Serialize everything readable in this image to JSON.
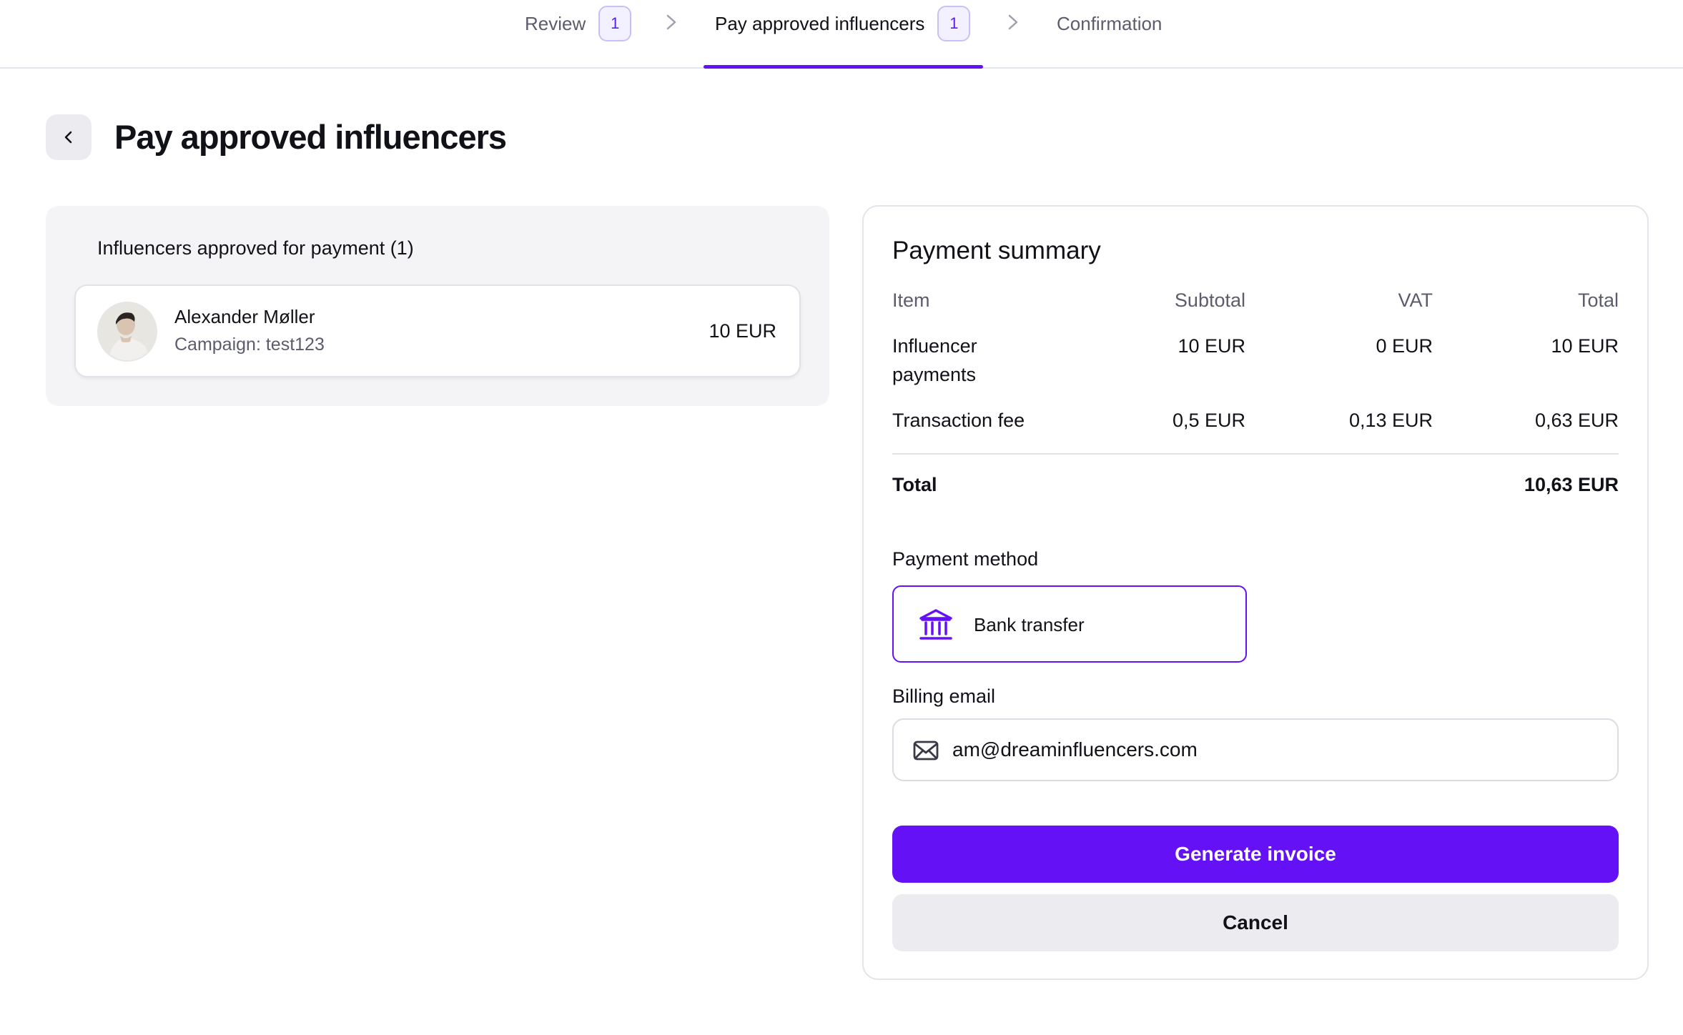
{
  "stepper": {
    "steps": [
      {
        "label": "Review",
        "count": "1"
      },
      {
        "label": "Pay approved influencers",
        "count": "1"
      },
      {
        "label": "Confirmation"
      }
    ],
    "active_index": 1
  },
  "page": {
    "title": "Pay approved influencers",
    "back_icon": "chevron-left-icon"
  },
  "influencers": {
    "heading": "Influencers approved for payment (1)",
    "items": [
      {
        "name": "Alexander Møller",
        "campaign": "Campaign: test123",
        "amount": "10 EUR"
      }
    ]
  },
  "summary": {
    "title": "Payment summary",
    "columns": [
      "Item",
      "Subtotal",
      "VAT",
      "Total"
    ],
    "rows": [
      {
        "item": "Influencer",
        "item2": "payments",
        "subtotal": "10 EUR",
        "vat": "0 EUR",
        "total": "10 EUR"
      },
      {
        "item": "Transaction fee",
        "subtotal": "0,5 EUR",
        "vat": "0,13 EUR",
        "total": "0,63 EUR"
      }
    ],
    "total_label": "Total",
    "total_value": "10,63 EUR"
  },
  "payment_method": {
    "label": "Payment method",
    "selected": "Bank transfer",
    "icon": "bank-icon"
  },
  "billing": {
    "label": "Billing email",
    "value": "am@dreaminfluencers.com",
    "icon": "envelope-icon"
  },
  "actions": {
    "generate_label": "Generate invoice",
    "cancel_label": "Cancel"
  },
  "colors": {
    "accent": "#6411f5",
    "badge_bg": "#f3f0ff",
    "panel_bg": "#f4f4f6",
    "muted_text": "#5c5c6e"
  }
}
